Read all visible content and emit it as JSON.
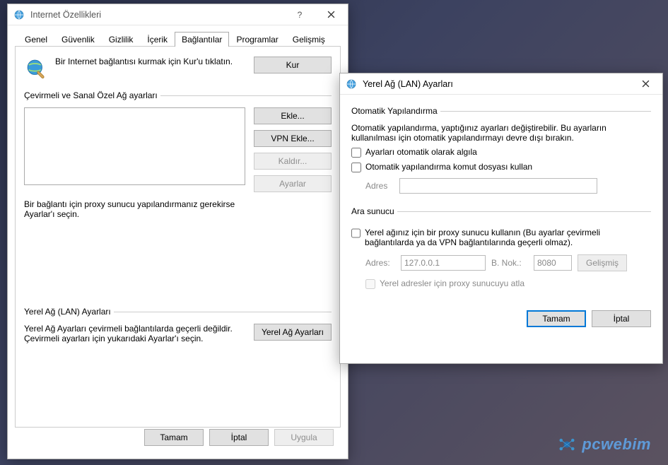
{
  "main": {
    "title": "Internet Özellikleri",
    "tabs": [
      "Genel",
      "Güvenlik",
      "Gizlilik",
      "İçerik",
      "Bağlantılar",
      "Programlar",
      "Gelişmiş"
    ],
    "active_tab_index": 4,
    "setup_text": "Bir Internet bağlantısı kurmak için Kur'u tıklatın.",
    "setup_button": "Kur",
    "dialup_legend": "Çevirmeli ve Sanal Özel Ağ ayarları",
    "add_button": "Ekle...",
    "vpn_add_button": "VPN Ekle...",
    "remove_button": "Kaldır...",
    "settings_button": "Ayarlar",
    "proxy_note": "Bir bağlantı için proxy sunucu yapılandırmanız gerekirse Ayarlar'ı seçin.",
    "lan_legend": "Yerel Ağ (LAN) Ayarları",
    "lan_note": "Yerel Ağ Ayarları çevirmeli bağlantılarda geçerli değildir. Çevirmeli ayarları için yukarıdaki Ayarlar'ı seçin.",
    "lan_button": "Yerel Ağ Ayarları",
    "ok": "Tamam",
    "cancel": "İptal",
    "apply": "Uygula"
  },
  "lan": {
    "title": "Yerel Ağ (LAN) Ayarları",
    "auto_legend": "Otomatik Yapılandırma",
    "auto_note": "Otomatik yapılandırma, yaptığınız ayarları değiştirebilir. Bu ayarların kullanılması için otomatik yapılandırmayı devre dışı bırakın.",
    "auto_detect": "Ayarları otomatik olarak algıla",
    "auto_script": "Otomatik yapılandırma komut dosyası kullan",
    "address_label": "Adres",
    "proxy_legend": "Ara sunucu",
    "proxy_use": "Yerel ağınız için bir proxy sunucu kullanın (Bu ayarlar çevirmeli bağlantılarda ya da VPN bağlantılarında geçerli olmaz).",
    "proxy_address_label": "Adres:",
    "proxy_address_value": "127.0.0.1",
    "proxy_port_label": "B. Nok.:",
    "proxy_port_value": "8080",
    "advanced_button": "Gelişmiş",
    "bypass_local": "Yerel adresler için proxy sunucuyu atla",
    "ok": "Tamam",
    "cancel": "İptal"
  },
  "watermark": "pcwebim"
}
